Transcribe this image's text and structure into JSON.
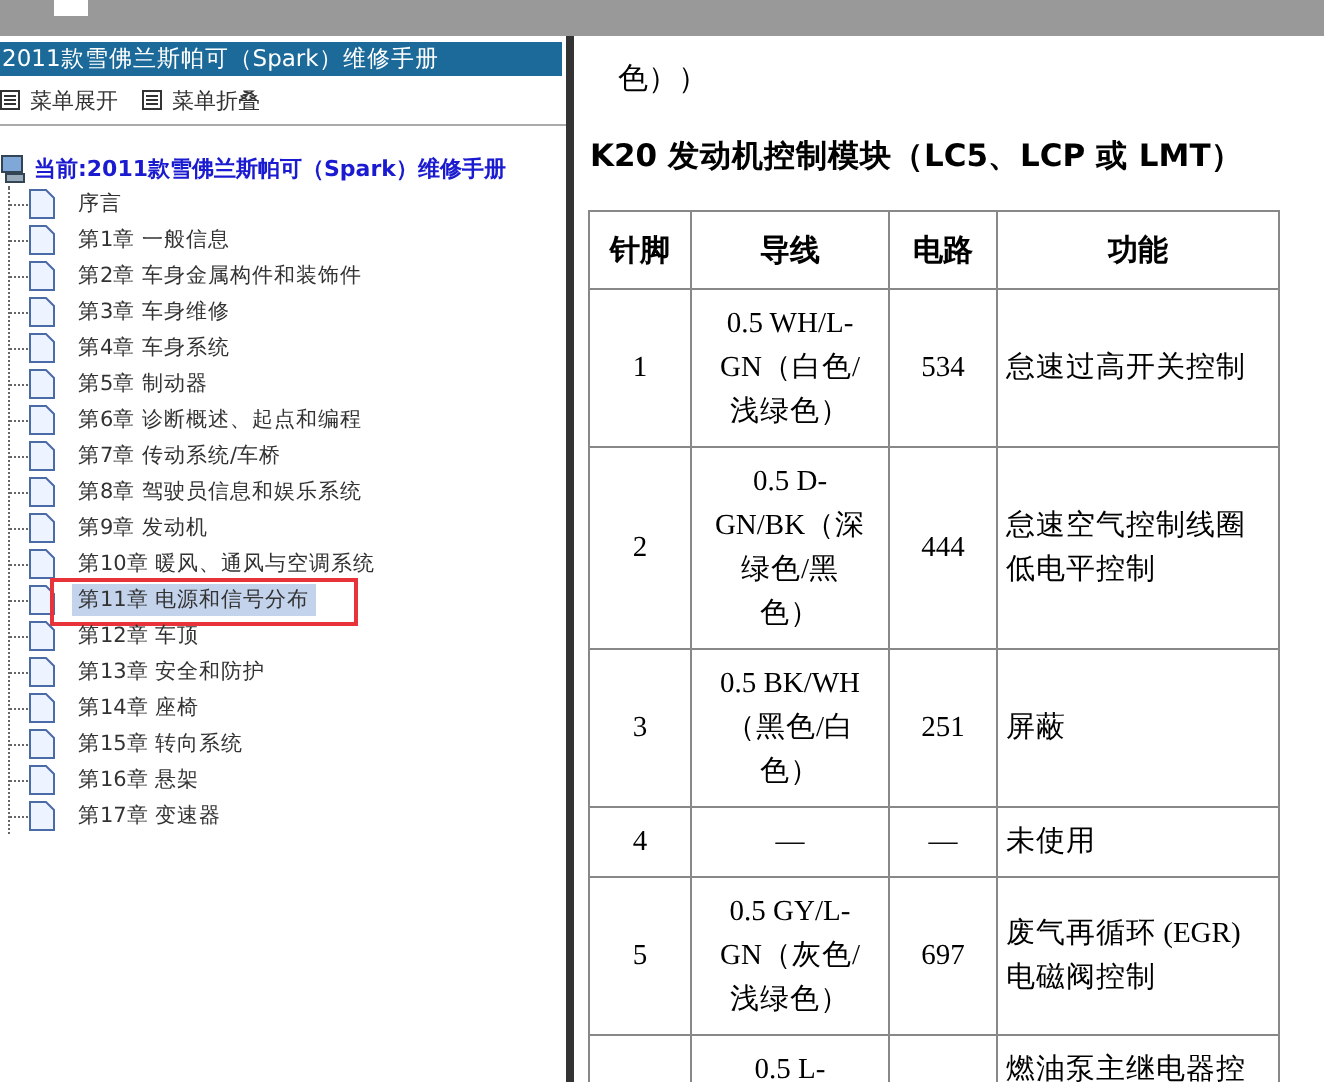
{
  "sidebar": {
    "title": "2011款雪佛兰斯帕可（Spark）维修手册",
    "menu_buttons": [
      "菜单展开",
      "菜单折叠"
    ],
    "tree": {
      "label": "当前:2011款雪佛兰斯帕可（Spark）维修手册",
      "children": [
        {
          "label": "序言",
          "selected": false
        },
        {
          "label": "第1章 一般信息",
          "selected": false
        },
        {
          "label": "第2章 车身金属构件和装饰件",
          "selected": false
        },
        {
          "label": "第3章 车身维修",
          "selected": false
        },
        {
          "label": "第4章 车身系统",
          "selected": false
        },
        {
          "label": "第5章 制动器",
          "selected": false
        },
        {
          "label": "第6章 诊断概述、起点和编程",
          "selected": false
        },
        {
          "label": "第7章 传动系统/车桥",
          "selected": false
        },
        {
          "label": "第8章 驾驶员信息和娱乐系统",
          "selected": false
        },
        {
          "label": "第9章 发动机",
          "selected": false
        },
        {
          "label": "第10章 暖风、通风与空调系统",
          "selected": false
        },
        {
          "label": "第11章 电源和信号分布",
          "selected": true
        },
        {
          "label": "第12章 车顶",
          "selected": false
        },
        {
          "label": "第13章 安全和防护",
          "selected": false
        },
        {
          "label": "第14章 座椅",
          "selected": false
        },
        {
          "label": "第15章 转向系统",
          "selected": false
        },
        {
          "label": "第16章 悬架",
          "selected": false
        },
        {
          "label": "第17章 变速器",
          "selected": false
        }
      ]
    }
  },
  "content": {
    "partial_text": "色））",
    "heading": "K20 发动机控制模块（LC5、LCP 或 LMT）",
    "table": {
      "columns": [
        "针脚",
        "导线",
        "电路",
        "功能"
      ],
      "rows": [
        [
          "1",
          "0.5 WH/L-GN（白色/浅绿色）",
          "534",
          "怠速过高开关控制"
        ],
        [
          "2",
          "0.5 D-GN/BK（深绿色/黑色）",
          "444",
          "怠速空气控制线圈低电平控制"
        ],
        [
          "3",
          "0.5 BK/WH（黑色/白色）",
          "251",
          "屏蔽"
        ],
        [
          "4",
          "—",
          "—",
          "未使用"
        ],
        [
          "5",
          "0.5 GY/L-GN（灰色/浅绿色）",
          "697",
          "废气再循环 (EGR) 电磁阀控制"
        ],
        [
          "",
          "0.5 L-",
          "",
          "燃油泵主继电器控"
        ]
      ]
    }
  }
}
